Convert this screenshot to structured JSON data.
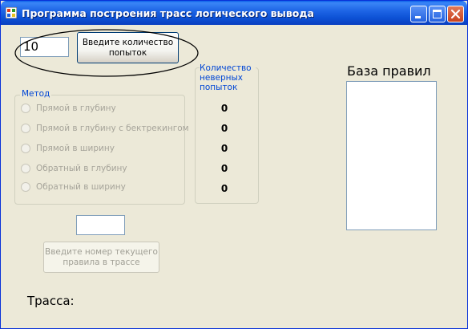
{
  "window": {
    "title": "Программа построения трасс логического вывода"
  },
  "attempts_input": {
    "value": "10"
  },
  "attempts_button": {
    "label": "Введите количество попыток"
  },
  "method_group": {
    "title": "Метод",
    "options": [
      "Прямой в глубину",
      "Прямой в глубину с бектрекингом",
      "Прямой в ширину",
      "Обратный в глубину",
      "Обратный в ширину"
    ]
  },
  "wrong_attempts": {
    "title": "Количество неверных попыток",
    "counts": [
      "0",
      "0",
      "0",
      "0",
      "0"
    ]
  },
  "rules_base": {
    "title": "База правил"
  },
  "rule_number_input": {
    "value": ""
  },
  "rule_number_button": {
    "label": "Введите номер текущего правила в трассе"
  },
  "trace": {
    "label": "Трасса:"
  },
  "colors": {
    "title_bar": "#0A52D6",
    "group_title": "#0046D5",
    "disabled_text": "#A6A49A",
    "annotation_ellipse": "#000000"
  }
}
